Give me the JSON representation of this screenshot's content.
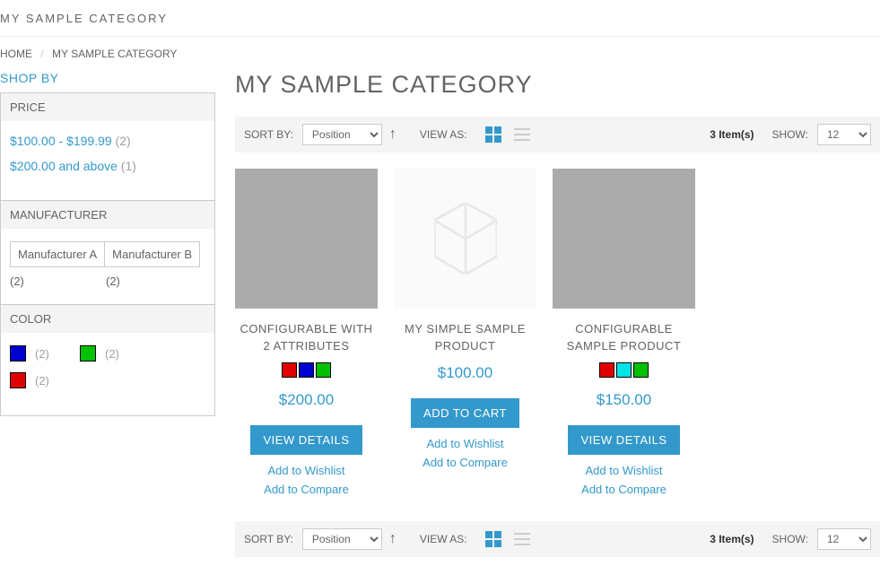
{
  "top_bar": {
    "title": "MY SAMPLE CATEGORY"
  },
  "breadcrumbs": {
    "home": "HOME",
    "current": "MY SAMPLE CATEGORY",
    "sep": "/"
  },
  "sidebar": {
    "title": "SHOP BY",
    "filters": {
      "price": {
        "label": "PRICE",
        "items": [
          {
            "label": "$100.00 - $199.99",
            "count": "(2)"
          },
          {
            "label": "$200.00 and above",
            "count": "(1)"
          }
        ]
      },
      "manufacturer": {
        "label": "MANUFACTURER",
        "options": [
          {
            "label": "Manufacturer A",
            "count": "(2)"
          },
          {
            "label": "Manufacturer B",
            "count": "(2)"
          }
        ]
      },
      "color": {
        "label": "COLOR",
        "options": [
          {
            "hex": "#0000d0",
            "count": "(2)"
          },
          {
            "hex": "#00c000",
            "count": "(2)"
          },
          {
            "hex": "#e00000",
            "count": "(2)"
          }
        ]
      }
    }
  },
  "heading": "MY SAMPLE CATEGORY",
  "toolbar": {
    "sort_label": "SORT BY:",
    "sort_value": "Position",
    "view_label": "VIEW AS:",
    "item_count": "3 Item(s)",
    "show_label": "SHOW:",
    "show_value": "12"
  },
  "products": [
    {
      "name": "CONFIGURABLE WITH 2 ATTRIBUTES",
      "img": "grey",
      "swatches": [
        "#e00000",
        "#0000d0",
        "#00c000"
      ],
      "price": "$200.00",
      "cta": "VIEW DETAILS"
    },
    {
      "name": "MY SIMPLE SAMPLE PRODUCT",
      "img": "placeholder",
      "swatches": [],
      "price": "$100.00",
      "cta": "ADD TO CART"
    },
    {
      "name": "CONFIGURABLE SAMPLE PRODUCT",
      "img": "grey",
      "swatches": [
        "#e00000",
        "#00e4e8",
        "#00c000"
      ],
      "price": "$150.00",
      "cta": "VIEW DETAILS"
    }
  ],
  "labels": {
    "wishlist": "Add to Wishlist",
    "compare": "Add to Compare"
  }
}
